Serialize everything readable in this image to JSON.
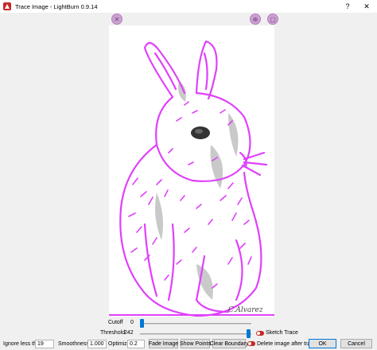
{
  "window": {
    "title": "Trace Image - LightBurn 0.9.14",
    "help_glyph": "?",
    "close_glyph": "✕"
  },
  "preview": {
    "signature": "C.Alvarez",
    "icons": {
      "top_left": "close-circle-icon",
      "top_right_1": "zoom-icon",
      "top_right_2": "image-icon"
    }
  },
  "controls": {
    "cutoff_label": "Cutoff",
    "cutoff_value": "0",
    "cutoff_level": 0.0,
    "threshold_label": "Threshold",
    "threshold_value": "242",
    "threshold_level": 0.95,
    "sketch_trace_label": "Sketch Trace",
    "ignore_label": "Ignore less than",
    "ignore_value": "19",
    "smoothness_label": "Smoothness",
    "smoothness_value": "1.000",
    "optimize_label": "Optimize",
    "optimize_value": "0.2",
    "fade_image": "Fade Image",
    "show_points": "Show Points",
    "clear_boundary": "Clear Boundary",
    "delete_after_label": "Delete image after trace",
    "ok": "OK",
    "cancel": "Cancel"
  },
  "colors": {
    "trace": "#e040fb",
    "toggle": "#c62828",
    "accent": "#0078d7"
  }
}
